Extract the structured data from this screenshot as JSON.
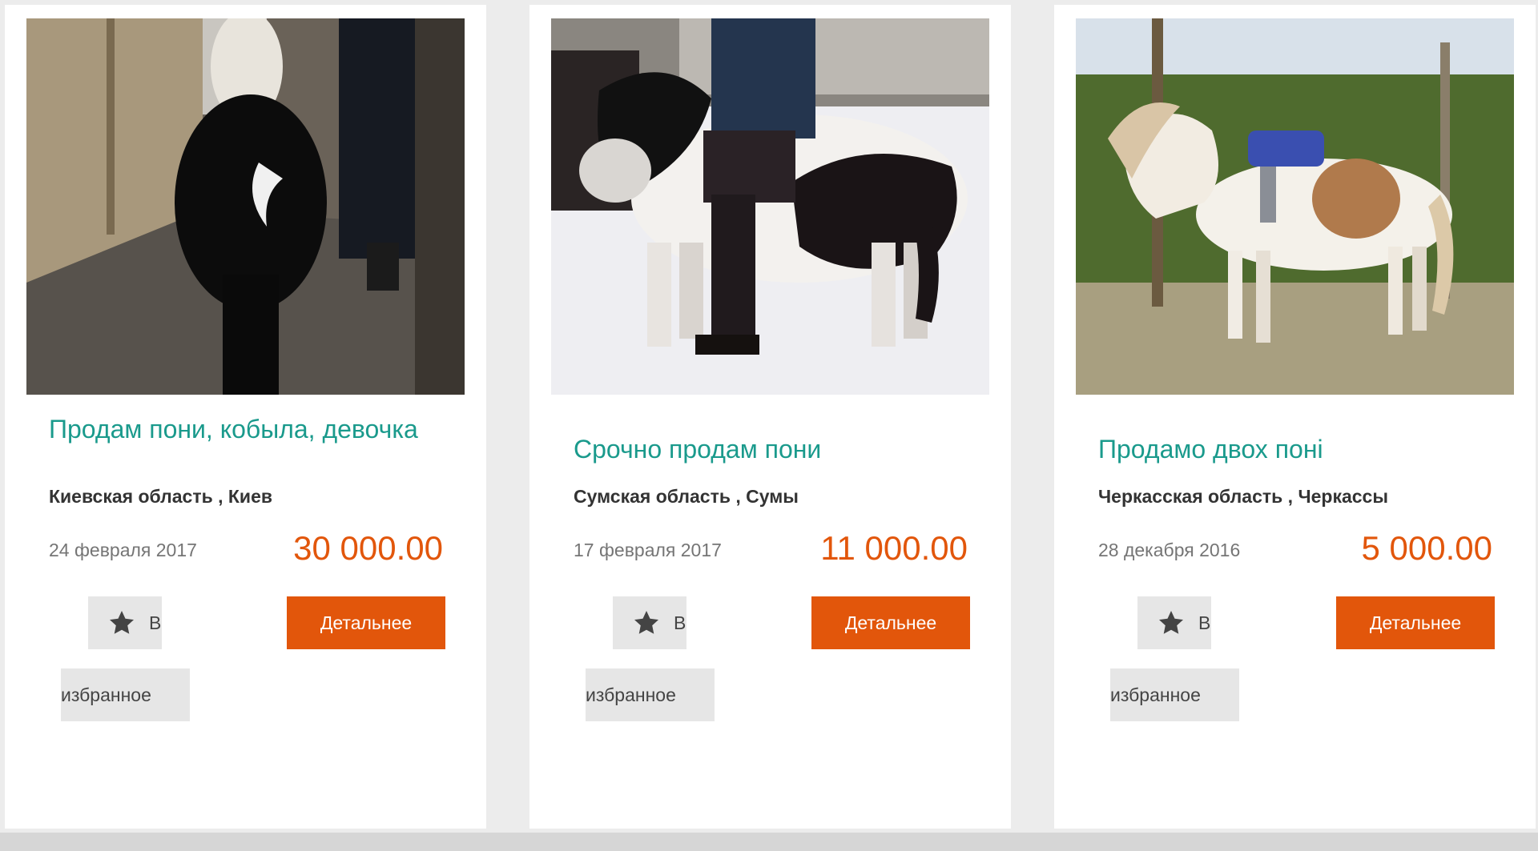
{
  "listings": [
    {
      "title": "Продам пони, кобыла, девочка",
      "location": "Киевская область , Киев",
      "date": "24 февраля 2017",
      "price": "30 000.00",
      "favorite_label_part1": "В",
      "favorite_label_part2": "избранное",
      "details_label": "Детальнее"
    },
    {
      "title": "Срочно продам пони",
      "location": "Сумская область , Сумы",
      "date": "17 февраля 2017",
      "price": "11 000.00",
      "favorite_label_part1": "В",
      "favorite_label_part2": "избранное",
      "details_label": "Детальнее"
    },
    {
      "title": "Продамо двох поні",
      "location": "Черкасская область , Черкассы",
      "date": "28 декабря 2016",
      "price": "5 000.00",
      "favorite_label_part1": "В",
      "favorite_label_part2": "избранное",
      "details_label": "Детальнее"
    }
  ],
  "colors": {
    "title": "#1a9a8c",
    "price": "#e2560b",
    "button": "#e2560b",
    "favorite_bg": "#e6e6e6"
  },
  "icons": {
    "favorite": "star-icon"
  }
}
